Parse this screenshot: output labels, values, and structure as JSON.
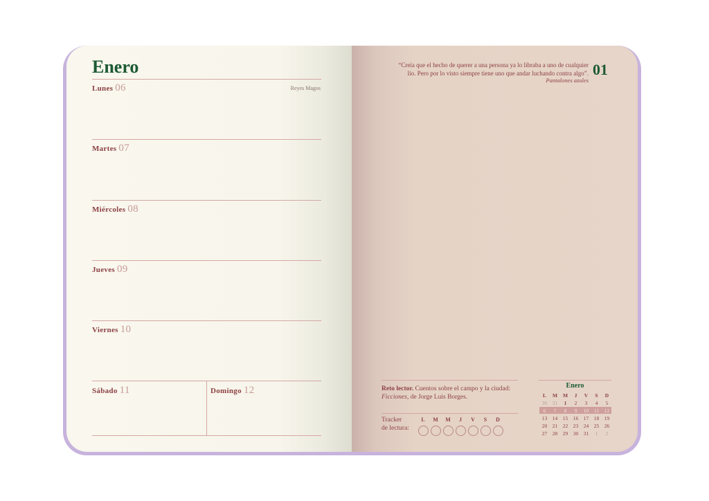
{
  "left": {
    "month": "Enero",
    "days": [
      {
        "name": "Lunes",
        "num": "06",
        "note": "Reyes Magos"
      },
      {
        "name": "Martes",
        "num": "07"
      },
      {
        "name": "Miércoles",
        "num": "08"
      },
      {
        "name": "Jueves",
        "num": "09"
      },
      {
        "name": "Viernes",
        "num": "10"
      },
      {
        "name": "Sábado",
        "num": "11"
      },
      {
        "name": "Domingo",
        "num": "12"
      }
    ]
  },
  "right": {
    "week_number": "01",
    "quote_line1": "“Creía que el hecho de querer a una persona ya lo libraba a uno de cualquier",
    "quote_line2": "lío. Pero por lo visto siempre tiene uno que andar luchando contra algo”.",
    "quote_source": "Pantalones azules",
    "reto": {
      "label": "Reto lector.",
      "text": " Cuentos sobre el campo y la ciudad:",
      "book": "Ficciones",
      "author": ", de Jorge Luis Borges."
    },
    "tracker": {
      "label_line1": "Tracker",
      "label_line2": "de lectura:",
      "days": [
        "L",
        "M",
        "M",
        "J",
        "V",
        "S",
        "D"
      ]
    },
    "mini_calendar": {
      "title": "Enero",
      "headers": [
        "L",
        "M",
        "M",
        "J",
        "V",
        "S",
        "D"
      ],
      "rows": [
        [
          "30",
          "31",
          "1",
          "2",
          "3",
          "4",
          "5"
        ],
        [
          "6",
          "7",
          "8",
          "9",
          "10",
          "11",
          "12"
        ],
        [
          "13",
          "14",
          "15",
          "16",
          "17",
          "18",
          "19"
        ],
        [
          "20",
          "21",
          "22",
          "23",
          "24",
          "25",
          "26"
        ],
        [
          "27",
          "28",
          "29",
          "30",
          "31",
          "1",
          "2"
        ]
      ],
      "highlight_week": 2
    }
  },
  "colors": {
    "green": "#1c5a34",
    "maroon": "#8c3f43",
    "rule": "#d4a7a4",
    "cover": "#c7b3dd"
  }
}
